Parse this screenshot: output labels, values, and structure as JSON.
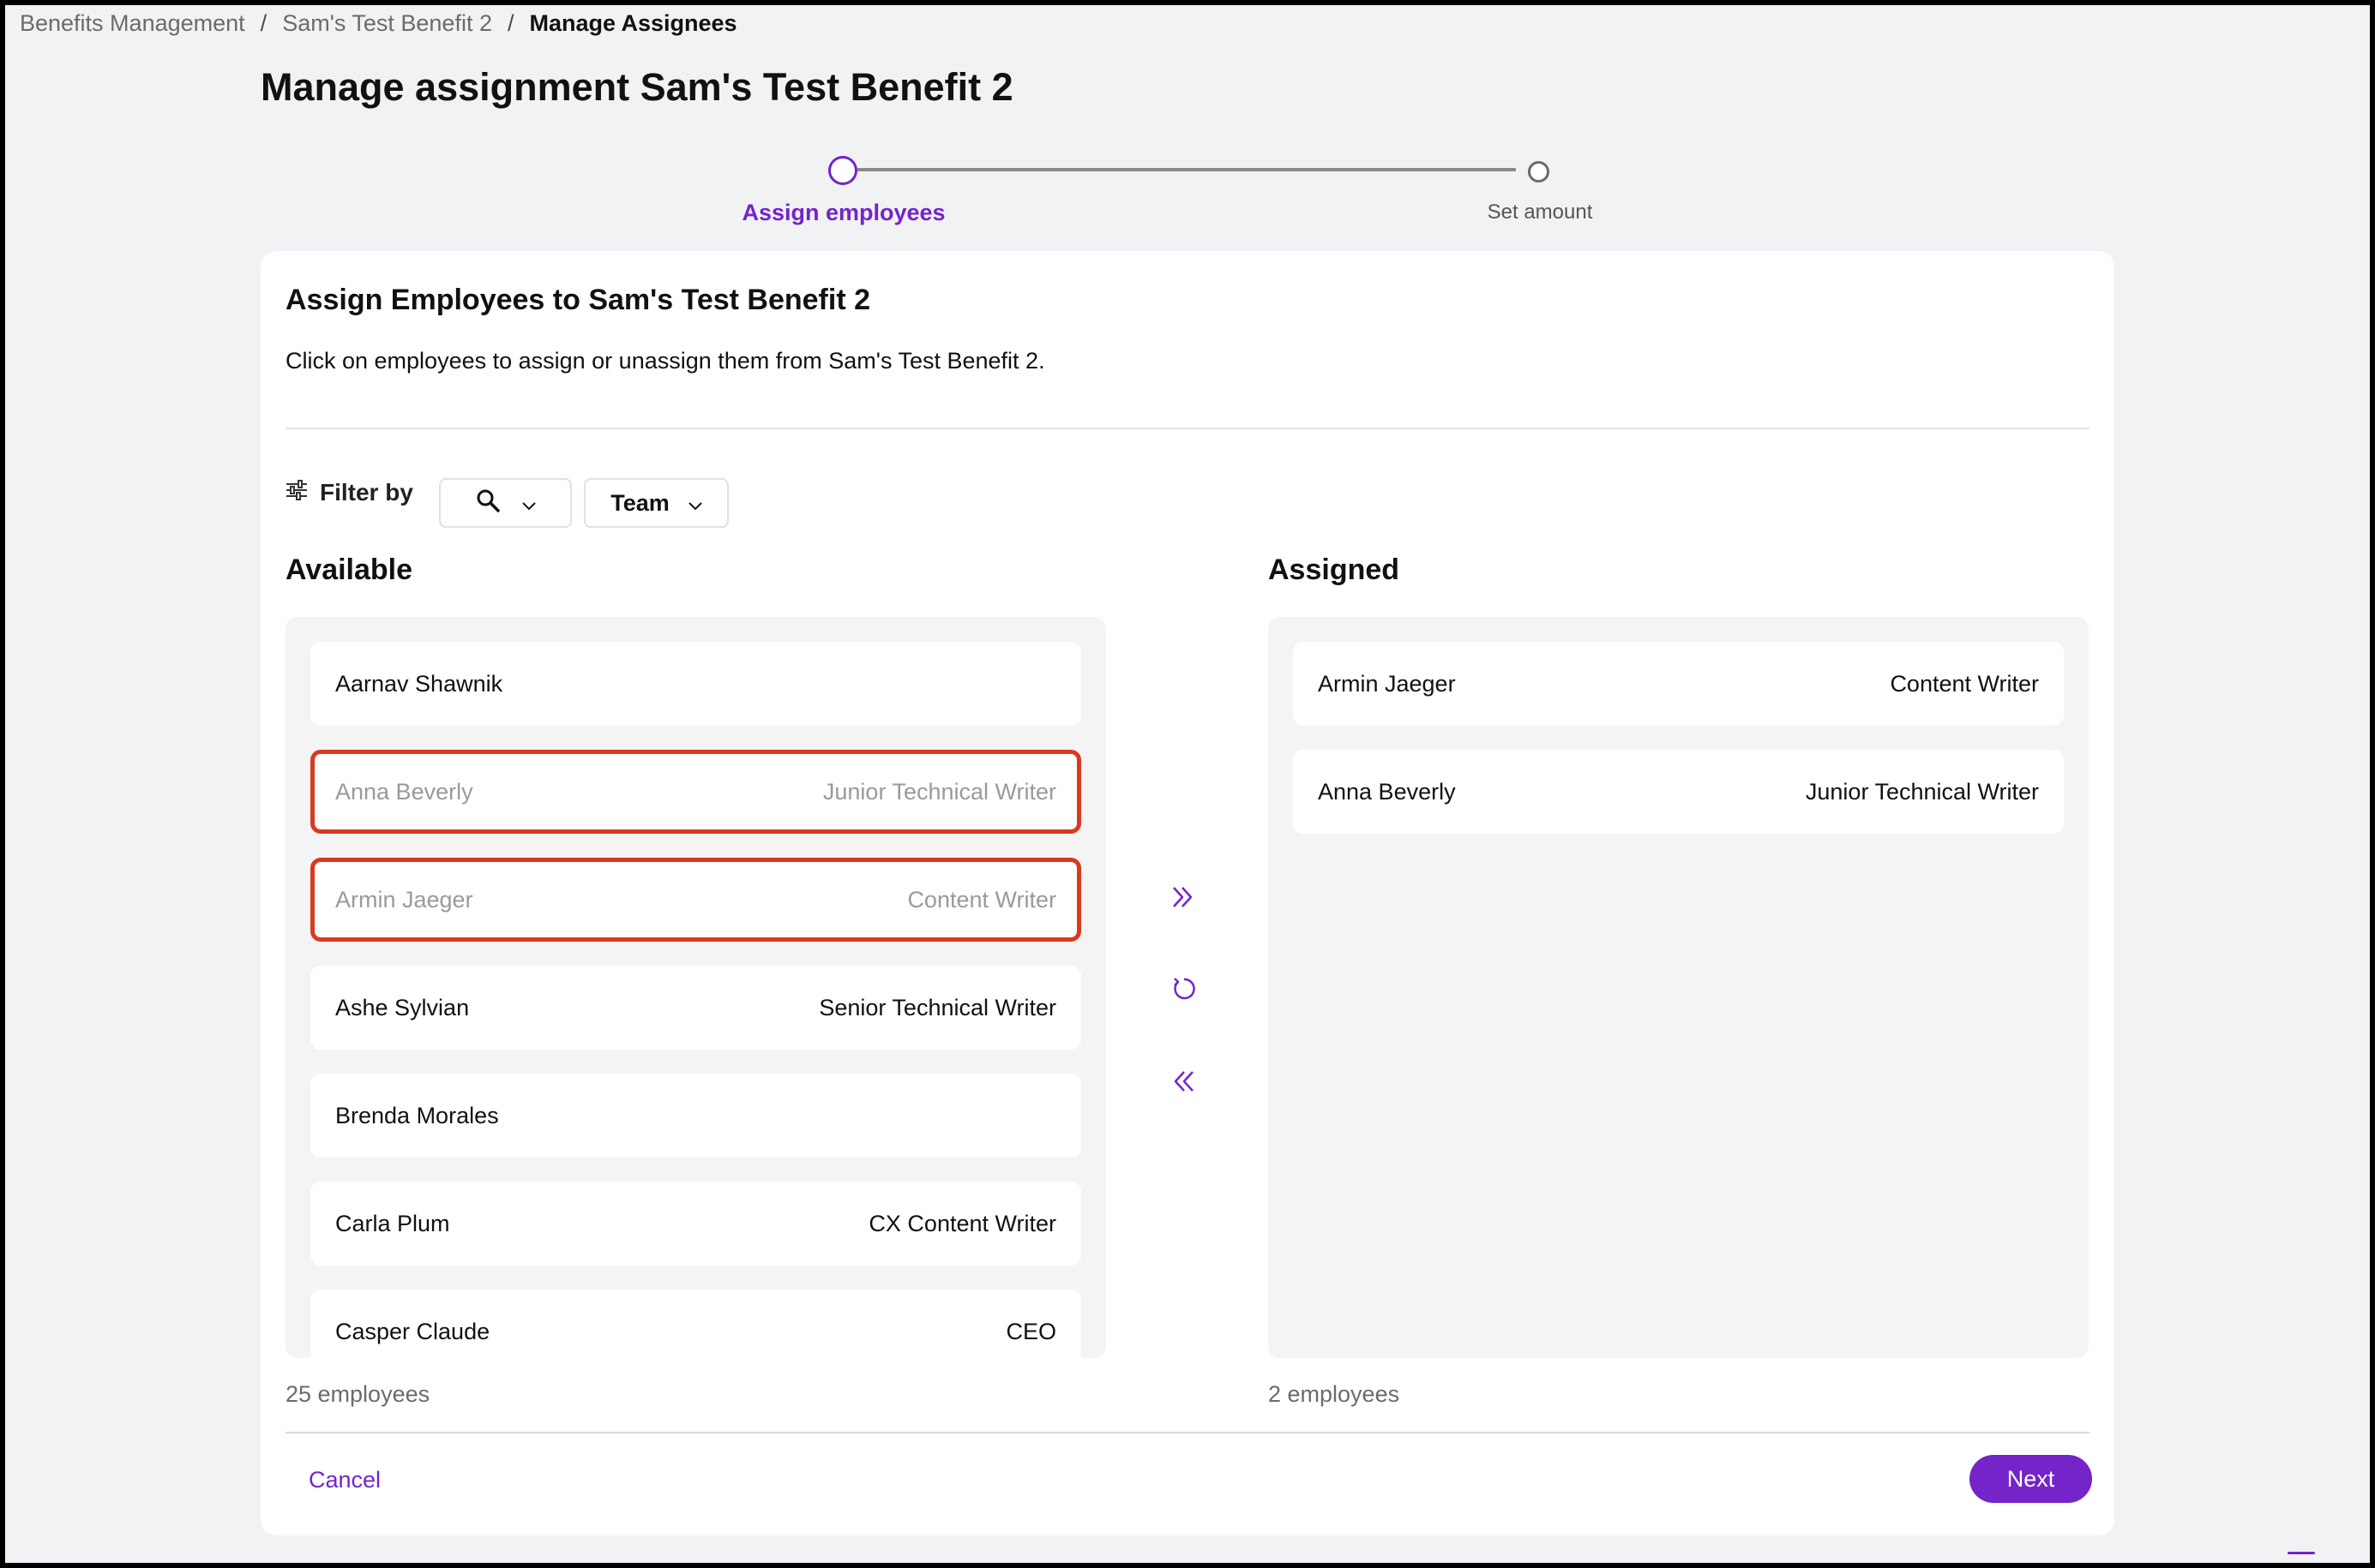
{
  "breadcrumb": {
    "items": [
      "Benefits Management",
      "Sam's Test Benefit 2"
    ],
    "current": "Manage Assignees",
    "separator": "/"
  },
  "page_title": "Manage assignment Sam's Test Benefit 2",
  "stepper": {
    "steps": [
      {
        "label": "Assign employees",
        "active": true
      },
      {
        "label": "Set amount",
        "active": false
      }
    ]
  },
  "card": {
    "title": "Assign Employees to Sam's Test Benefit 2",
    "description": "Click on employees to assign or unassign them from Sam's Test Benefit 2."
  },
  "filter": {
    "label": "Filter by",
    "search_icon": "search-icon",
    "team_label": "Team"
  },
  "available": {
    "title": "Available",
    "count_label": "25 employees",
    "rows": [
      {
        "name": "Aarnav Shawnik",
        "role": "",
        "selected": false
      },
      {
        "name": "Anna Beverly",
        "role": "Junior Technical Writer",
        "selected": true
      },
      {
        "name": "Armin Jaeger",
        "role": "Content Writer",
        "selected": true
      },
      {
        "name": "Ashe Sylvian",
        "role": "Senior Technical Writer",
        "selected": false
      },
      {
        "name": "Brenda Morales",
        "role": "",
        "selected": false
      },
      {
        "name": "Carla Plum",
        "role": "CX Content Writer",
        "selected": false
      },
      {
        "name": "Casper Claude",
        "role": "CEO",
        "selected": false
      }
    ]
  },
  "assigned": {
    "title": "Assigned",
    "count_label": "2 employees",
    "rows": [
      {
        "name": "Armin Jaeger",
        "role": "Content Writer"
      },
      {
        "name": "Anna Beverly",
        "role": "Junior Technical Writer"
      }
    ]
  },
  "transfer": {
    "move_right_icon": "chevrons-right-icon",
    "reset_icon": "refresh-icon",
    "move_left_icon": "chevrons-left-icon"
  },
  "footer": {
    "cancel_label": "Cancel",
    "next_label": "Next"
  },
  "colors": {
    "accent": "#7424c9",
    "selected_border": "#d8391f",
    "background": "#f1f2f4",
    "panel": "#f4f4f4"
  }
}
